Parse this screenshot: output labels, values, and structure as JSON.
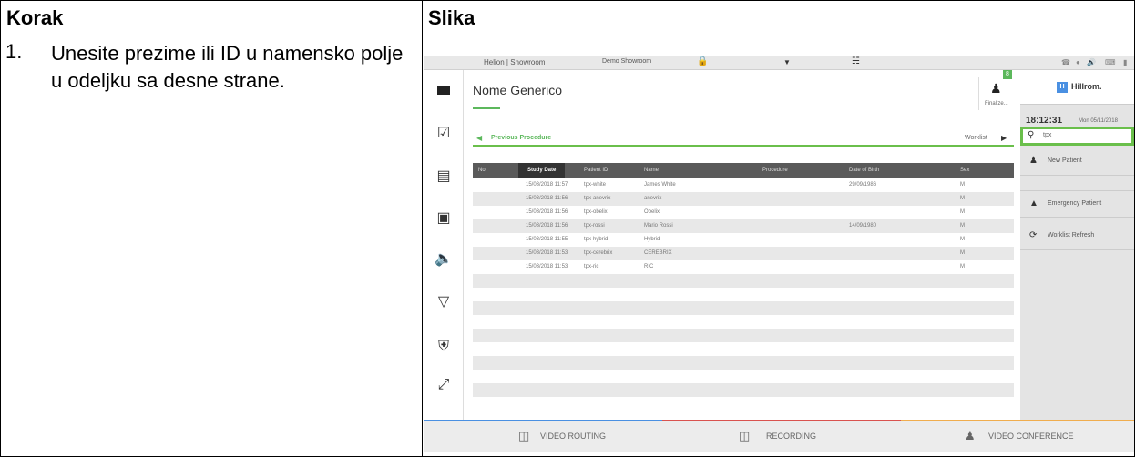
{
  "table": {
    "col1_header": "Korak",
    "col2_header": "Slika",
    "step_number": "1.",
    "step_text": "Unesite prezime ili ID u namensko polje u odeljku sa desne strane."
  },
  "screen": {
    "topbar": {
      "title": "Helion | Showroom",
      "room": "Demo Showroom"
    },
    "patient_name": "Nome Generico",
    "finalize_badge": "8",
    "finalize_label": "Finalize...",
    "previous_procedure": "Previous Procedure",
    "worklist_label": "Worklist",
    "columns": [
      "No.",
      "Study Date",
      "Patient ID",
      "Name",
      "Procedure",
      "Date of Birth",
      "Sex"
    ],
    "rows": [
      [
        "",
        "15/03/2018 11:57",
        "tpx-white",
        "James White",
        "",
        "29/09/1986",
        "M"
      ],
      [
        "",
        "15/03/2018 11:56",
        "tpx-anevrix",
        "anevrix",
        "",
        "",
        "M"
      ],
      [
        "",
        "15/03/2018 11:56",
        "tpx-obelix",
        "Obelix",
        "",
        "",
        "M"
      ],
      [
        "",
        "15/03/2018 11:56",
        "tpx-rossi",
        "Mario Rossi",
        "",
        "14/09/1980",
        "M"
      ],
      [
        "",
        "15/03/2018 11:55",
        "tpx-hybrid",
        "Hybrid",
        "",
        "",
        "M"
      ],
      [
        "",
        "15/03/2018 11:53",
        "tpx-cerebrix",
        "CEREBRIX",
        "",
        "",
        "M"
      ],
      [
        "",
        "15/03/2018 11:53",
        "tpx-ric",
        "RIC",
        "",
        "",
        "M"
      ]
    ],
    "right": {
      "brand": "Hillrom.",
      "time": "18:12:31",
      "date": "Mon 05/11/2018",
      "search_value": "tpx",
      "new_patient": "New Patient",
      "emergency_patient": "Emergency Patient",
      "worklist_refresh": "Worklist Refresh"
    },
    "bottom": {
      "video_routing": "VIDEO ROUTING",
      "recording": "RECORDING",
      "video_conference": "VIDEO CONFERENCE"
    },
    "colors": {
      "accent_green": "#5cb85c",
      "highlight_green": "#6abf4b",
      "header_dark": "#5a5a5a",
      "blue_line": "#4a90e2",
      "red_line": "#d9534f",
      "orange_line": "#f0ad4e"
    }
  }
}
